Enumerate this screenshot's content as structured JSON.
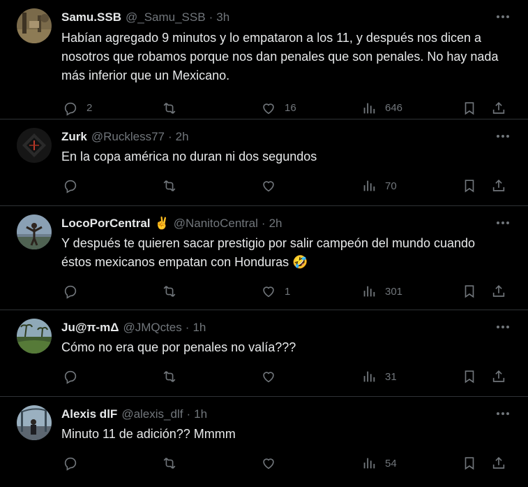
{
  "tweets": [
    {
      "name": "Samu.SSB",
      "handle": "@_Samu_SSB",
      "time": "3h",
      "badge": "",
      "text": "Habían agregado 9 minutos y lo empataron a los 11, y después nos dicen a nosotros que robamos porque nos dan penales que son penales. No hay nada más inferior que un Mexicano.",
      "replies": "2",
      "reposts": "",
      "likes": "16",
      "views": "646"
    },
    {
      "name": "Zurk",
      "handle": "@Ruckless77",
      "time": "2h",
      "badge": "",
      "text": "En la copa américa no duran ni dos segundos",
      "replies": "",
      "reposts": "",
      "likes": "",
      "views": "70"
    },
    {
      "name": "LocoPorCentral",
      "handle": "@NanitoCentral",
      "time": "2h",
      "badge": "✌️",
      "text": "Y después te quieren sacar prestigio por salir campeón del mundo cuando éstos mexicanos empatan con Honduras 🤣",
      "replies": "",
      "reposts": "",
      "likes": "1",
      "views": "301"
    },
    {
      "name": "Ju@π-mΔ",
      "handle": "@JMQctes",
      "time": "1h",
      "badge": "",
      "text": "Cómo no era que por penales no valía???",
      "replies": "",
      "reposts": "",
      "likes": "",
      "views": "31"
    },
    {
      "name": "Alexis dlF",
      "handle": "@alexis_dlf",
      "time": "1h",
      "badge": "",
      "text": "Minuto 11 de adición?? Mmmm",
      "replies": "",
      "reposts": "",
      "likes": "",
      "views": "54"
    }
  ],
  "separator": "·",
  "colors": {
    "background": "#000000",
    "text": "#e7e9ea",
    "muted": "#71767b",
    "border": "#2f3336"
  },
  "icons": [
    "more-icon",
    "reply-icon",
    "repost-icon",
    "like-icon",
    "views-icon",
    "bookmark-icon",
    "share-icon"
  ]
}
